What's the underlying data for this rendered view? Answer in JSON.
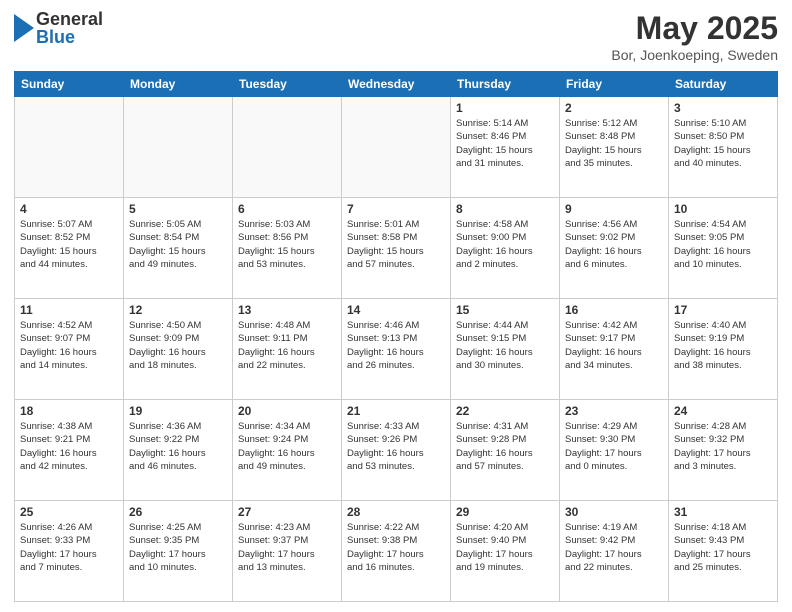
{
  "header": {
    "logo": {
      "general": "General",
      "blue": "Blue"
    },
    "title": "May 2025",
    "subtitle": "Bor, Joenkoeping, Sweden"
  },
  "weekdays": [
    "Sunday",
    "Monday",
    "Tuesday",
    "Wednesday",
    "Thursday",
    "Friday",
    "Saturday"
  ],
  "weeks": [
    [
      {
        "day": "",
        "info": ""
      },
      {
        "day": "",
        "info": ""
      },
      {
        "day": "",
        "info": ""
      },
      {
        "day": "",
        "info": ""
      },
      {
        "day": "1",
        "info": "Sunrise: 5:14 AM\nSunset: 8:46 PM\nDaylight: 15 hours\nand 31 minutes."
      },
      {
        "day": "2",
        "info": "Sunrise: 5:12 AM\nSunset: 8:48 PM\nDaylight: 15 hours\nand 35 minutes."
      },
      {
        "day": "3",
        "info": "Sunrise: 5:10 AM\nSunset: 8:50 PM\nDaylight: 15 hours\nand 40 minutes."
      }
    ],
    [
      {
        "day": "4",
        "info": "Sunrise: 5:07 AM\nSunset: 8:52 PM\nDaylight: 15 hours\nand 44 minutes."
      },
      {
        "day": "5",
        "info": "Sunrise: 5:05 AM\nSunset: 8:54 PM\nDaylight: 15 hours\nand 49 minutes."
      },
      {
        "day": "6",
        "info": "Sunrise: 5:03 AM\nSunset: 8:56 PM\nDaylight: 15 hours\nand 53 minutes."
      },
      {
        "day": "7",
        "info": "Sunrise: 5:01 AM\nSunset: 8:58 PM\nDaylight: 15 hours\nand 57 minutes."
      },
      {
        "day": "8",
        "info": "Sunrise: 4:58 AM\nSunset: 9:00 PM\nDaylight: 16 hours\nand 2 minutes."
      },
      {
        "day": "9",
        "info": "Sunrise: 4:56 AM\nSunset: 9:02 PM\nDaylight: 16 hours\nand 6 minutes."
      },
      {
        "day": "10",
        "info": "Sunrise: 4:54 AM\nSunset: 9:05 PM\nDaylight: 16 hours\nand 10 minutes."
      }
    ],
    [
      {
        "day": "11",
        "info": "Sunrise: 4:52 AM\nSunset: 9:07 PM\nDaylight: 16 hours\nand 14 minutes."
      },
      {
        "day": "12",
        "info": "Sunrise: 4:50 AM\nSunset: 9:09 PM\nDaylight: 16 hours\nand 18 minutes."
      },
      {
        "day": "13",
        "info": "Sunrise: 4:48 AM\nSunset: 9:11 PM\nDaylight: 16 hours\nand 22 minutes."
      },
      {
        "day": "14",
        "info": "Sunrise: 4:46 AM\nSunset: 9:13 PM\nDaylight: 16 hours\nand 26 minutes."
      },
      {
        "day": "15",
        "info": "Sunrise: 4:44 AM\nSunset: 9:15 PM\nDaylight: 16 hours\nand 30 minutes."
      },
      {
        "day": "16",
        "info": "Sunrise: 4:42 AM\nSunset: 9:17 PM\nDaylight: 16 hours\nand 34 minutes."
      },
      {
        "day": "17",
        "info": "Sunrise: 4:40 AM\nSunset: 9:19 PM\nDaylight: 16 hours\nand 38 minutes."
      }
    ],
    [
      {
        "day": "18",
        "info": "Sunrise: 4:38 AM\nSunset: 9:21 PM\nDaylight: 16 hours\nand 42 minutes."
      },
      {
        "day": "19",
        "info": "Sunrise: 4:36 AM\nSunset: 9:22 PM\nDaylight: 16 hours\nand 46 minutes."
      },
      {
        "day": "20",
        "info": "Sunrise: 4:34 AM\nSunset: 9:24 PM\nDaylight: 16 hours\nand 49 minutes."
      },
      {
        "day": "21",
        "info": "Sunrise: 4:33 AM\nSunset: 9:26 PM\nDaylight: 16 hours\nand 53 minutes."
      },
      {
        "day": "22",
        "info": "Sunrise: 4:31 AM\nSunset: 9:28 PM\nDaylight: 16 hours\nand 57 minutes."
      },
      {
        "day": "23",
        "info": "Sunrise: 4:29 AM\nSunset: 9:30 PM\nDaylight: 17 hours\nand 0 minutes."
      },
      {
        "day": "24",
        "info": "Sunrise: 4:28 AM\nSunset: 9:32 PM\nDaylight: 17 hours\nand 3 minutes."
      }
    ],
    [
      {
        "day": "25",
        "info": "Sunrise: 4:26 AM\nSunset: 9:33 PM\nDaylight: 17 hours\nand 7 minutes."
      },
      {
        "day": "26",
        "info": "Sunrise: 4:25 AM\nSunset: 9:35 PM\nDaylight: 17 hours\nand 10 minutes."
      },
      {
        "day": "27",
        "info": "Sunrise: 4:23 AM\nSunset: 9:37 PM\nDaylight: 17 hours\nand 13 minutes."
      },
      {
        "day": "28",
        "info": "Sunrise: 4:22 AM\nSunset: 9:38 PM\nDaylight: 17 hours\nand 16 minutes."
      },
      {
        "day": "29",
        "info": "Sunrise: 4:20 AM\nSunset: 9:40 PM\nDaylight: 17 hours\nand 19 minutes."
      },
      {
        "day": "30",
        "info": "Sunrise: 4:19 AM\nSunset: 9:42 PM\nDaylight: 17 hours\nand 22 minutes."
      },
      {
        "day": "31",
        "info": "Sunrise: 4:18 AM\nSunset: 9:43 PM\nDaylight: 17 hours\nand 25 minutes."
      }
    ]
  ]
}
